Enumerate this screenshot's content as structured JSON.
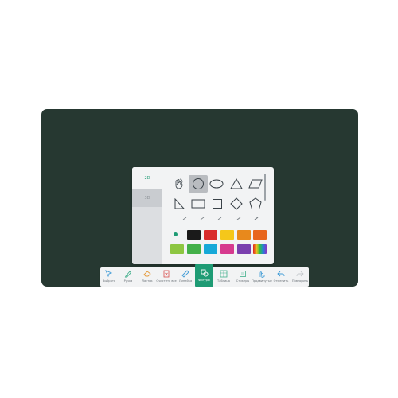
{
  "board": {
    "color": "#263831"
  },
  "shape_panel": {
    "side_tabs": [
      {
        "label": "2D"
      },
      {
        "label": "3D"
      }
    ],
    "shapes": [
      {
        "icon": "shape-recognition-icon"
      },
      {
        "icon": "circle-icon",
        "selected": true
      },
      {
        "icon": "ellipse-icon"
      },
      {
        "icon": "triangle-icon"
      },
      {
        "icon": "parallelogram-icon"
      },
      {
        "icon": "right-triangle-icon"
      },
      {
        "icon": "rectangle-icon"
      },
      {
        "icon": "square-icon"
      },
      {
        "icon": "diamond-icon"
      },
      {
        "icon": "pentagon-icon"
      }
    ],
    "line_styles": [
      "line-style-1",
      "line-style-2",
      "line-style-3",
      "line-style-4",
      "line-style-5"
    ],
    "colors": [
      "#1a1a1a",
      "#d92b2b",
      "#f5c71a",
      "#e8891c",
      "#e8661c",
      "#8dc641",
      "#43b049",
      "#16a9d8",
      "#d63a8e",
      "#7a3fae",
      "#rainbow"
    ],
    "accent": "#1e9b74"
  },
  "toolbar": {
    "items": [
      {
        "label": "Выбрать",
        "icon": "cursor-icon"
      },
      {
        "label": "Ручка",
        "icon": "pen-icon"
      },
      {
        "label": "Ластик",
        "icon": "eraser-icon"
      },
      {
        "label": "Очистить все",
        "icon": "clear-all-icon"
      },
      {
        "label": "Линейка",
        "icon": "ruler-icon"
      },
      {
        "label": "Фигуры",
        "icon": "shapes-icon",
        "active": true
      },
      {
        "label": "Таблица",
        "icon": "table-icon"
      },
      {
        "label": "Стикеры",
        "icon": "sticker-icon"
      },
      {
        "label": "Продвинутые",
        "icon": "advanced-icon"
      },
      {
        "label": "Отменить",
        "icon": "undo-icon"
      },
      {
        "label": "Повторить",
        "icon": "redo-icon"
      }
    ]
  }
}
